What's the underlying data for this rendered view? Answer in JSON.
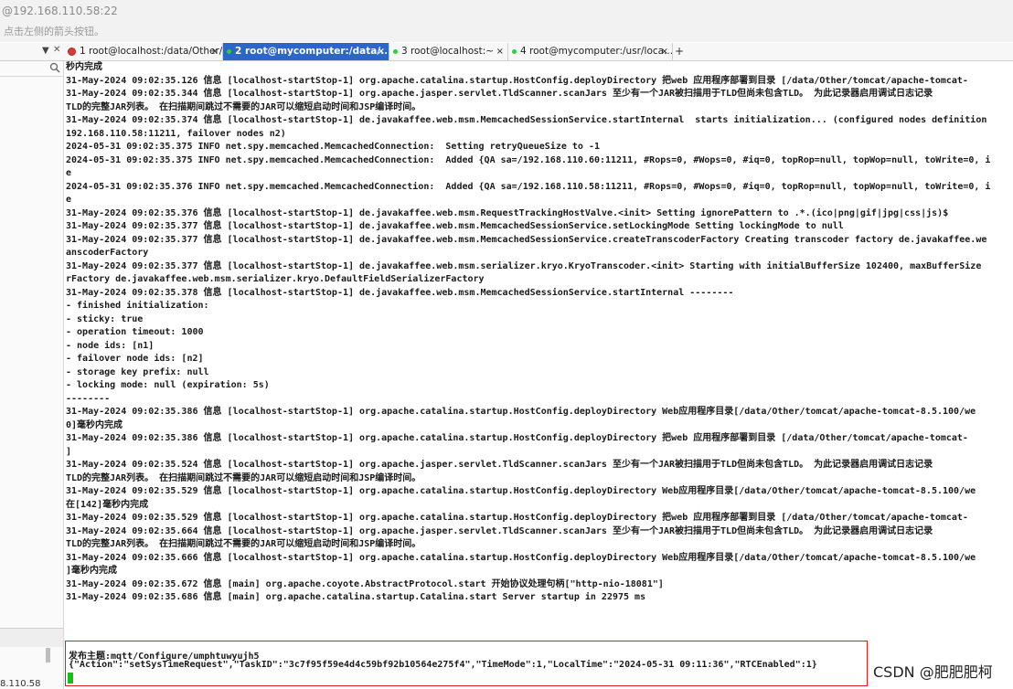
{
  "window": {
    "title": "@192.168.110.58:22",
    "hint": "点击左侧的箭头按钮。"
  },
  "tabs": [
    {
      "label": "1 root@localhost:/data/Other/...",
      "status_color": "#d23b3b"
    },
    {
      "label": "2 root@mycomputer:/data/...",
      "status_color": "#2ecc40"
    },
    {
      "label": "3 root@localhost:~",
      "status_color": "#2ecc40"
    },
    {
      "label": "4 root@mycomputer:/usr/loca...",
      "status_color": "#2ecc40"
    }
  ],
  "sidebar": {
    "ip_tail": "8.110.58"
  },
  "terminal": {
    "lines": [
      "秒内完成",
      "31-May-2024 09:02:35.126 信息 [localhost-startStop-1] org.apache.catalina.startup.HostConfig.deployDirectory 把web 应用程序部署到目录 [/data/Other/tomcat/apache-tomcat-",
      "31-May-2024 09:02:35.344 信息 [localhost-startStop-1] org.apache.jasper.servlet.TldScanner.scanJars 至少有一个JAR被扫描用于TLD但尚未包含TLD。 为此记录器启用调试日志记录",
      "TLD的完整JAR列表。 在扫描期间跳过不需要的JAR可以缩短启动时间和JSP编译时间。",
      "31-May-2024 09:02:35.374 信息 [localhost-startStop-1] de.javakaffee.web.msm.MemcachedSessionService.startInternal  starts initialization... (configured nodes definition",
      "192.168.110.58:11211, failover nodes n2)",
      "2024-05-31 09:02:35.375 INFO net.spy.memcached.MemcachedConnection:  Setting retryQueueSize to -1",
      "2024-05-31 09:02:35.375 INFO net.spy.memcached.MemcachedConnection:  Added {QA sa=/192.168.110.60:11211, #Rops=0, #Wops=0, #iq=0, topRop=null, topWop=null, toWrite=0, i",
      "e",
      "2024-05-31 09:02:35.376 INFO net.spy.memcached.MemcachedConnection:  Added {QA sa=/192.168.110.58:11211, #Rops=0, #Wops=0, #iq=0, topRop=null, topWop=null, toWrite=0, i",
      "e",
      "31-May-2024 09:02:35.376 信息 [localhost-startStop-1] de.javakaffee.web.msm.RequestTrackingHostValve.<init> Setting ignorePattern to .*.(ico|png|gif|jpg|css|js)$",
      "31-May-2024 09:02:35.377 信息 [localhost-startStop-1] de.javakaffee.web.msm.MemcachedSessionService.setLockingMode Setting lockingMode to null",
      "31-May-2024 09:02:35.377 信息 [localhost-startStop-1] de.javakaffee.web.msm.MemcachedSessionService.createTranscoderFactory Creating transcoder factory de.javakaffee.we",
      "anscoderFactory",
      "31-May-2024 09:02:35.377 信息 [localhost-startStop-1] de.javakaffee.web.msm.serializer.kryo.KryoTranscoder.<init> Starting with initialBufferSize 102400, maxBufferSize",
      "rFactory de.javakaffee.web.msm.serializer.kryo.DefaultFieldSerializerFactory",
      "31-May-2024 09:02:35.378 信息 [localhost-startStop-1] de.javakaffee.web.msm.MemcachedSessionService.startInternal --------",
      "- finished initialization:",
      "- sticky: true",
      "- operation timeout: 1000",
      "- node ids: [n1]",
      "- failover node ids: [n2]",
      "- storage key prefix: null",
      "- locking mode: null (expiration: 5s)",
      "--------",
      "31-May-2024 09:02:35.386 信息 [localhost-startStop-1] org.apache.catalina.startup.HostConfig.deployDirectory Web应用程序目录[/data/Other/tomcat/apache-tomcat-8.5.100/we",
      "0]毫秒内完成",
      "31-May-2024 09:02:35.386 信息 [localhost-startStop-1] org.apache.catalina.startup.HostConfig.deployDirectory 把web 应用程序部署到目录 [/data/Other/tomcat/apache-tomcat-",
      "]",
      "31-May-2024 09:02:35.524 信息 [localhost-startStop-1] org.apache.jasper.servlet.TldScanner.scanJars 至少有一个JAR被扫描用于TLD但尚未包含TLD。 为此记录器启用调试日志记录",
      "TLD的完整JAR列表。 在扫描期间跳过不需要的JAR可以缩短启动时间和JSP编译时间。",
      "31-May-2024 09:02:35.529 信息 [localhost-startStop-1] org.apache.catalina.startup.HostConfig.deployDirectory Web应用程序目录[/data/Other/tomcat/apache-tomcat-8.5.100/we",
      "在[142]毫秒内完成",
      "31-May-2024 09:02:35.529 信息 [localhost-startStop-1] org.apache.catalina.startup.HostConfig.deployDirectory 把web 应用程序部署到目录 [/data/Other/tomcat/apache-tomcat-",
      "31-May-2024 09:02:35.664 信息 [localhost-startStop-1] org.apache.jasper.servlet.TldScanner.scanJars 至少有一个JAR被扫描用于TLD但尚未包含TLD。 为此记录器启用调试日志记录",
      "TLD的完整JAR列表。 在扫描期间跳过不需要的JAR可以缩短启动时间和JSP编译时间。",
      "31-May-2024 09:02:35.666 信息 [localhost-startStop-1] org.apache.catalina.startup.HostConfig.deployDirectory Web应用程序目录[/data/Other/tomcat/apache-tomcat-8.5.100/we",
      "]毫秒内完成",
      "31-May-2024 09:02:35.672 信息 [main] org.apache.coyote.AbstractProtocol.start 开始协议处理句柄[\"http-nio-18081\"]",
      "31-May-2024 09:02:35.686 信息 [main] org.apache.catalina.startup.Catalina.start Server startup in 22975 ms"
    ],
    "publish_topic": "发布主题:mqtt/Configure/umphtuwyujh5",
    "publish_payload": "{\"Action\":\"setSysTimeRequest\",\"TaskID\":\"3c7f95f59e4d4c59bf92b10564e275f4\",\"TimeMode\":1,\"LocalTime\":\"2024-05-31 09:11:36\",\"RTCEnabled\":1}"
  },
  "watermark": "CSDN @肥肥肥柯",
  "colors": {
    "active_tab": "#2b66c8",
    "highlight_border": "#e01b1b",
    "cursor": "#16c116"
  }
}
